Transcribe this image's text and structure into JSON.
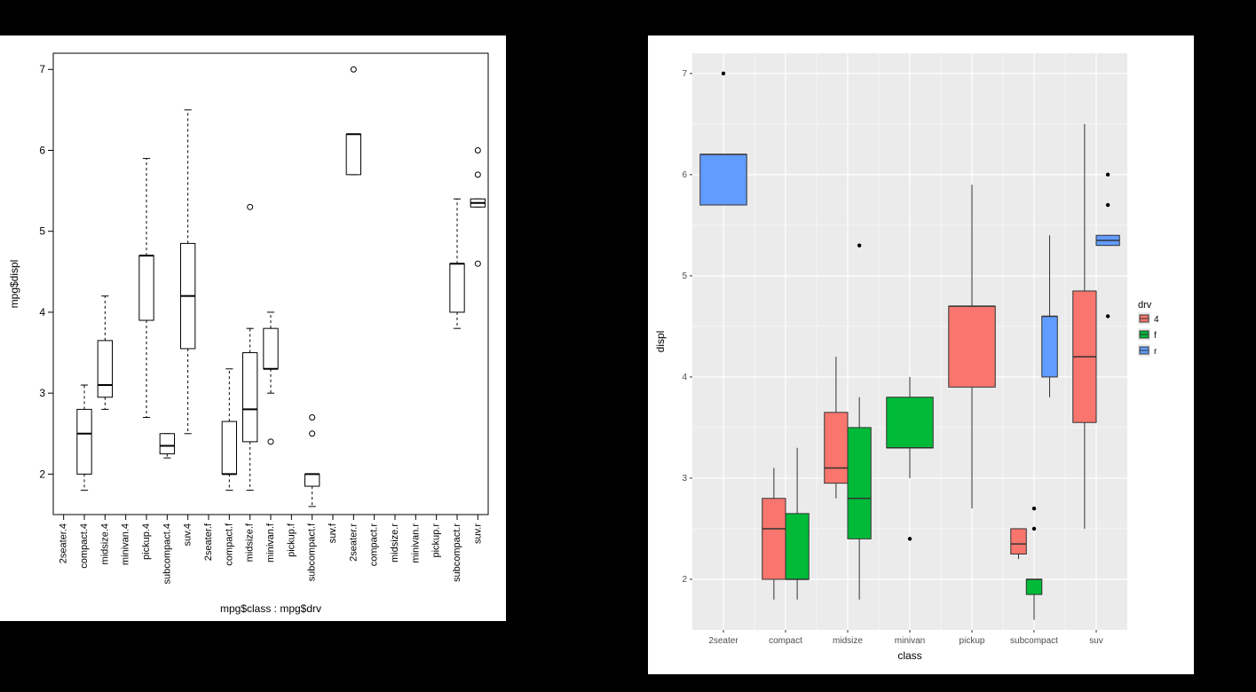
{
  "chart_data": [
    {
      "type": "boxplot",
      "engine": "base-R",
      "xlabel": "mpg$class : mpg$drv",
      "ylabel": "mpg$displ",
      "ylim": [
        1.5,
        7.2
      ],
      "yticks": [
        2,
        3,
        4,
        5,
        6,
        7
      ],
      "categories": [
        "2seater.4",
        "compact.4",
        "midsize.4",
        "minivan.4",
        "pickup.4",
        "subcompact.4",
        "suv.4",
        "2seater.f",
        "compact.f",
        "midsize.f",
        "minivan.f",
        "pickup.f",
        "subcompact.f",
        "suv.f",
        "2seater.r",
        "compact.r",
        "midsize.r",
        "minivan.r",
        "pickup.r",
        "subcompact.r",
        "suv.r"
      ],
      "boxes": [
        {
          "cat": "2seater.4",
          "empty": true
        },
        {
          "cat": "compact.4",
          "min": 1.8,
          "q1": 2.0,
          "med": 2.5,
          "q3": 2.8,
          "max": 3.1,
          "out": []
        },
        {
          "cat": "midsize.4",
          "min": 2.8,
          "q1": 2.95,
          "med": 3.1,
          "q3": 3.65,
          "max": 4.2,
          "out": []
        },
        {
          "cat": "minivan.4",
          "empty": true
        },
        {
          "cat": "pickup.4",
          "min": 2.7,
          "q1": 3.9,
          "med": 4.7,
          "q3": 4.7,
          "max": 5.9,
          "out": []
        },
        {
          "cat": "subcompact.4",
          "min": 2.2,
          "q1": 2.25,
          "med": 2.35,
          "q3": 2.5,
          "max": 2.5,
          "out": []
        },
        {
          "cat": "suv.4",
          "min": 2.5,
          "q1": 3.55,
          "med": 4.2,
          "q3": 4.85,
          "max": 6.5,
          "out": []
        },
        {
          "cat": "2seater.f",
          "empty": true
        },
        {
          "cat": "compact.f",
          "min": 1.8,
          "q1": 2.0,
          "med": 2.0,
          "q3": 2.65,
          "max": 3.3,
          "out": []
        },
        {
          "cat": "midsize.f",
          "min": 1.8,
          "q1": 2.4,
          "med": 2.8,
          "q3": 3.5,
          "max": 3.8,
          "out": [
            5.3
          ]
        },
        {
          "cat": "minivan.f",
          "min": 3.0,
          "q1": 3.3,
          "med": 3.3,
          "q3": 3.8,
          "max": 4.0,
          "out": [
            2.4
          ]
        },
        {
          "cat": "pickup.f",
          "empty": true
        },
        {
          "cat": "subcompact.f",
          "min": 1.6,
          "q1": 1.85,
          "med": 2.0,
          "q3": 2.0,
          "max": 2.0,
          "out": [
            2.5,
            2.7
          ]
        },
        {
          "cat": "suv.f",
          "empty": true
        },
        {
          "cat": "2seater.r",
          "min": 5.7,
          "q1": 5.7,
          "med": 6.2,
          "q3": 6.2,
          "max": 6.2,
          "out": [
            7.0
          ]
        },
        {
          "cat": "compact.r",
          "empty": true
        },
        {
          "cat": "midsize.r",
          "empty": true
        },
        {
          "cat": "minivan.r",
          "empty": true
        },
        {
          "cat": "pickup.r",
          "empty": true
        },
        {
          "cat": "subcompact.r",
          "min": 3.8,
          "q1": 4.0,
          "med": 4.6,
          "q3": 4.6,
          "max": 5.4,
          "out": []
        },
        {
          "cat": "suv.r",
          "min": 5.3,
          "q1": 5.3,
          "med": 5.35,
          "q3": 5.4,
          "max": 5.4,
          "out": [
            4.6,
            5.7,
            6.0
          ]
        }
      ]
    },
    {
      "type": "boxplot",
      "engine": "ggplot",
      "xlabel": "class",
      "ylabel": "displ",
      "legend_title": "drv",
      "ylim": [
        1.5,
        7.2
      ],
      "yticks": [
        2,
        3,
        4,
        5,
        6,
        7
      ],
      "x_categories": [
        "2seater",
        "compact",
        "midsize",
        "minivan",
        "pickup",
        "subcompact",
        "suv"
      ],
      "drv_levels": [
        "4",
        "f",
        "r"
      ],
      "colors": {
        "4": "#F8766D",
        "f": "#00BA38",
        "r": "#619CFF"
      },
      "boxes": [
        {
          "class": "2seater",
          "drv": "r",
          "min": 5.7,
          "q1": 5.7,
          "med": 6.2,
          "q3": 6.2,
          "max": 6.2,
          "out": [
            7.0
          ]
        },
        {
          "class": "compact",
          "drv": "4",
          "min": 1.8,
          "q1": 2.0,
          "med": 2.5,
          "q3": 2.8,
          "max": 3.1,
          "out": []
        },
        {
          "class": "compact",
          "drv": "f",
          "min": 1.8,
          "q1": 2.0,
          "med": 2.0,
          "q3": 2.65,
          "max": 3.3,
          "out": []
        },
        {
          "class": "midsize",
          "drv": "4",
          "min": 2.8,
          "q1": 2.95,
          "med": 3.1,
          "q3": 3.65,
          "max": 4.2,
          "out": []
        },
        {
          "class": "midsize",
          "drv": "f",
          "min": 1.8,
          "q1": 2.4,
          "med": 2.8,
          "q3": 3.5,
          "max": 3.8,
          "out": [
            5.3
          ]
        },
        {
          "class": "minivan",
          "drv": "f",
          "min": 3.0,
          "q1": 3.3,
          "med": 3.3,
          "q3": 3.8,
          "max": 4.0,
          "out": [
            2.4
          ]
        },
        {
          "class": "pickup",
          "drv": "4",
          "min": 2.7,
          "q1": 3.9,
          "med": 4.7,
          "q3": 4.7,
          "max": 5.9,
          "out": []
        },
        {
          "class": "subcompact",
          "drv": "4",
          "min": 2.2,
          "q1": 2.25,
          "med": 2.35,
          "q3": 2.5,
          "max": 2.5,
          "out": []
        },
        {
          "class": "subcompact",
          "drv": "f",
          "min": 1.6,
          "q1": 1.85,
          "med": 2.0,
          "q3": 2.0,
          "max": 2.0,
          "out": [
            2.5,
            2.7
          ]
        },
        {
          "class": "subcompact",
          "drv": "r",
          "min": 3.8,
          "q1": 4.0,
          "med": 4.6,
          "q3": 4.6,
          "max": 5.4,
          "out": []
        },
        {
          "class": "suv",
          "drv": "4",
          "min": 2.5,
          "q1": 3.55,
          "med": 4.2,
          "q3": 4.85,
          "max": 6.5,
          "out": []
        },
        {
          "class": "suv",
          "drv": "r",
          "min": 5.3,
          "q1": 5.3,
          "med": 5.35,
          "q3": 5.4,
          "max": 5.4,
          "out": [
            4.6,
            5.7,
            6.0
          ]
        }
      ]
    }
  ],
  "axis": {
    "left_y": "mpg$displ",
    "left_x": "mpg$class : mpg$drv",
    "right_y": "displ",
    "right_x": "class",
    "legend_title": "drv"
  }
}
